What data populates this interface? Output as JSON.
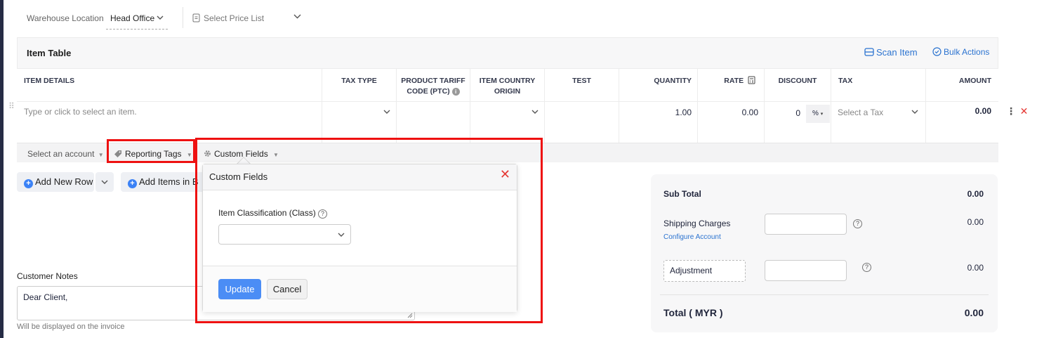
{
  "top": {
    "warehouse_label": "Warehouse Location",
    "warehouse_value": "Head Office",
    "price_list_placeholder": "Select Price List"
  },
  "item_table": {
    "title": "Item Table",
    "scan_item": "Scan Item",
    "bulk_actions": "Bulk Actions",
    "headers": {
      "item_details": "ITEM DETAILS",
      "tax_type": "TAX TYPE",
      "ptc_line1": "PRODUCT TARIFF",
      "ptc_line2": "CODE (PTC)",
      "origin_line1": "ITEM COUNTRY",
      "origin_line2": "ORIGIN",
      "test": "TEST",
      "quantity": "QUANTITY",
      "rate": "RATE",
      "discount": "DISCOUNT",
      "tax": "TAX",
      "amount": "AMOUNT"
    },
    "row": {
      "item_placeholder": "Type or click to select an item.",
      "quantity": "1.00",
      "rate": "0.00",
      "discount": "0",
      "discount_unit": "%",
      "tax_placeholder": "Select a Tax",
      "amount": "0.00"
    },
    "subrow": {
      "account": "Select an account",
      "reporting_tags": "Reporting Tags",
      "custom_fields": "Custom Fields"
    }
  },
  "actions": {
    "add_new_row": "Add New Row",
    "add_items_bulk": "Add Items in B"
  },
  "popover": {
    "title": "Custom Fields",
    "field_label": "Item Classification (Class)",
    "field_value": "",
    "update": "Update",
    "cancel": "Cancel"
  },
  "notes": {
    "label": "Customer Notes",
    "line1": "Dear Client,",
    "hint": "Will be displayed on the invoice"
  },
  "totals": {
    "sub_total_label": "Sub Total",
    "sub_total_value": "0.00",
    "shipping_label": "Shipping Charges",
    "configure_account": "Configure Account",
    "shipping_value": "0.00",
    "adjustment_label": "Adjustment",
    "adjustment_value": "0.00",
    "total_label": "Total ( MYR )",
    "total_value": "0.00"
  },
  "colors": {
    "accent": "#2b73d0",
    "highlight": "#e11111",
    "update_button": "#4b8df5"
  },
  "icons": [
    "chevron-down-icon",
    "document-icon",
    "scan-icon",
    "check-circle-icon",
    "info-icon",
    "calculator-icon",
    "tag-icon",
    "gear-icon",
    "close-icon",
    "plus-circle-icon",
    "help-icon",
    "drag-handle-icon",
    "kebab-icon"
  ]
}
